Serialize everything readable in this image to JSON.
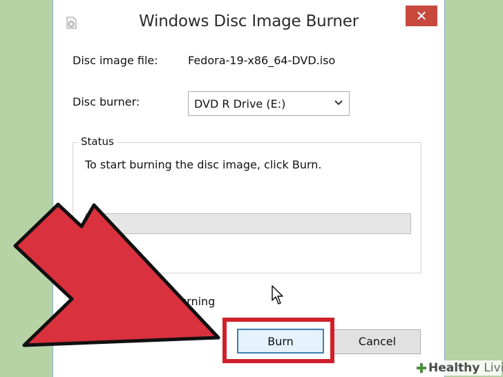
{
  "window": {
    "title": "Windows Disc Image Burner",
    "close_glyph": "✕"
  },
  "fields": {
    "disc_image_label": "Disc image file:",
    "disc_image_value": "Fedora-19-x86_64-DVD.iso",
    "disc_burner_label": "Disc burner:",
    "disc_burner_selected": "DVD R Drive (E:)"
  },
  "status": {
    "group_label": "Status",
    "message": "To start burning the disc image, click Burn.",
    "progress": 0
  },
  "options": {
    "verify_label_visible_part": "urning"
  },
  "buttons": {
    "burn": "Burn",
    "cancel": "Cancel"
  },
  "overlay": {
    "arrow_color": "#d9313d",
    "highlight_color": "#d0212b"
  },
  "watermark": {
    "part1": "Healthy",
    "part2": "Living"
  },
  "icons": [
    "app-disc-icon",
    "close-icon",
    "chevron-down-icon",
    "mouse-cursor-icon",
    "healthy-living-logo-icon"
  ]
}
